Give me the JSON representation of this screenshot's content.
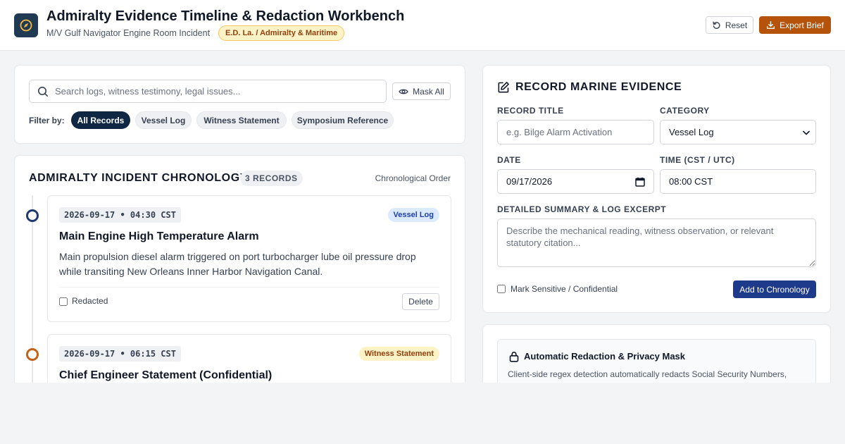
{
  "header": {
    "title": "Admiralty Evidence Timeline & Redaction Workbench",
    "subtitle": "M/V Gulf Navigator Engine Room Incident",
    "court_badge": "E.D. La. / Admiralty & Maritime",
    "reset_label": "Reset",
    "export_label": "Export Brief"
  },
  "search": {
    "placeholder": "Search logs, witness testimony, legal issues...",
    "value": "",
    "mask_all_label": "Mask All"
  },
  "filters": {
    "label": "Filter by:",
    "chips": [
      "All Records",
      "Vessel Log",
      "Witness Statement",
      "Symposium Reference"
    ],
    "active": "All Records"
  },
  "chronology": {
    "title": "ADMIRALTY INCIDENT CHRONOLOGY",
    "count_badge": "3 RECORDS",
    "order_label": "Chronological Order",
    "entries": [
      {
        "timestamp": "2026-09-17 • 04:30 CST",
        "category": "Vessel Log",
        "title": "Main Engine High Temperature Alarm",
        "body": "Main propulsion diesel alarm triggered on port turbocharger lube oil pressure drop while transiting New Orleans Inner Harbor Navigation Canal.",
        "redacted_label": "Redacted",
        "delete_label": "Delete"
      },
      {
        "timestamp": "2026-09-17 • 06:15 CST",
        "category": "Witness Statement",
        "title": "Chief Engineer Statement (Confidential)"
      }
    ]
  },
  "form": {
    "title": "RECORD MARINE EVIDENCE",
    "record_title_label": "RECORD TITLE",
    "record_title_placeholder": "e.g. Bilge Alarm Activation",
    "category_label": "CATEGORY",
    "category_value": "Vessel Log",
    "date_label": "DATE",
    "date_value": "09/17/2026",
    "time_label": "TIME (CST / UTC)",
    "time_value": "08:00 CST",
    "summary_label": "DETAILED SUMMARY & LOG EXCERPT",
    "summary_placeholder": "Describe the mechanical reading, witness observation, or relevant statutory citation...",
    "sensitive_label": "Mark Sensitive / Confidential",
    "add_label": "Add to Chronology"
  },
  "redaction": {
    "title": "Automatic Redaction & Privacy Mask",
    "description": "Client-side regex detection automatically redacts Social Security Numbers, seaman's birth dates and telephone contacts in all chronology entries before export."
  },
  "colors": {
    "navy": "#0f2742",
    "accent_orange": "#b45309",
    "vessel_log_badge_bg": "#dbeafe",
    "vessel_log_badge_text": "#1e40af",
    "witness_badge_bg": "#fef3c7",
    "witness_badge_text": "#92400e",
    "dot_vessel": "#1f3a6e",
    "dot_witness": "#c2621a",
    "add_button": "#1e3a8a"
  },
  "icons": {
    "logo": "compass-icon",
    "reset": "rotate-ccw-icon",
    "export": "download-icon",
    "search": "search-icon",
    "mask": "eye-icon",
    "form": "edit-icon",
    "redaction": "lock-icon",
    "calendar": "calendar-icon"
  }
}
